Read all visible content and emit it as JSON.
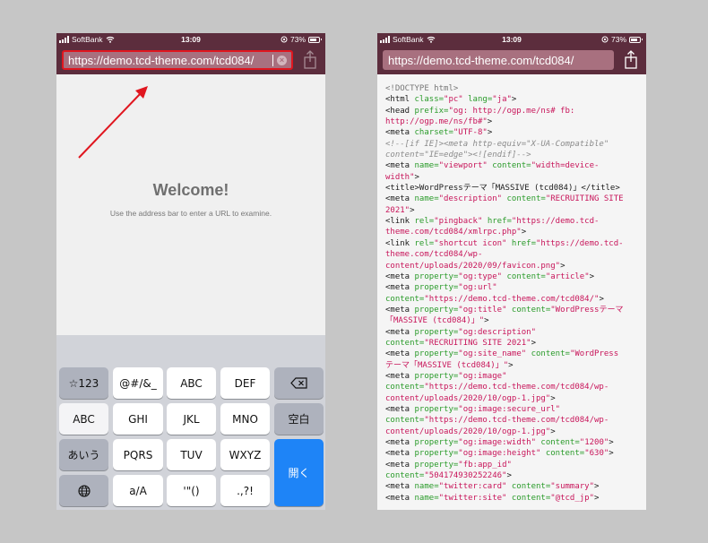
{
  "left_phone": {
    "status": {
      "carrier": "SoftBank",
      "time": "13:09",
      "battery": "73%"
    },
    "address": {
      "value": "https://demo.tcd-theme.com/tcd084/"
    },
    "welcome": {
      "title": "Welcome!",
      "subtitle": "Use the address bar to enter a URL to examine."
    },
    "keyboard": {
      "rows": [
        [
          "☆123",
          "@#/&_",
          "ABC",
          "DEF",
          "⌫"
        ],
        [
          "ABC",
          "GHI",
          "JKL",
          "MNO",
          "空白"
        ],
        [
          "あいう",
          "PQRS",
          "TUV",
          "WXYZ",
          "開く"
        ],
        [
          "globe",
          "a/A",
          "'\"()",
          ".,?!"
        ]
      ]
    }
  },
  "right_phone": {
    "status": {
      "carrier": "SoftBank",
      "time": "13:09",
      "battery": "73%"
    },
    "address": {
      "value": "https://demo.tcd-theme.com/tcd084/"
    },
    "source_lines": [
      [
        [
          "dt",
          "<!DOCTYPE html>"
        ]
      ],
      [
        [
          "tg",
          "<html "
        ],
        [
          "at",
          "class="
        ],
        [
          "vl",
          "\"pc\""
        ],
        [
          "tg",
          " "
        ],
        [
          "at",
          "lang="
        ],
        [
          "vl",
          "\"ja\""
        ],
        [
          "tg",
          ">"
        ]
      ],
      [
        [
          "tg",
          "<head "
        ],
        [
          "at",
          "prefix="
        ],
        [
          "vl",
          "\"og: http://ogp.me/ns# fb:"
        ]
      ],
      [
        [
          "vl",
          "http://ogp.me/ns/fb#\""
        ],
        [
          "tg",
          ">"
        ]
      ],
      [
        [
          "tg",
          "<meta "
        ],
        [
          "at",
          "charset="
        ],
        [
          "vl",
          "\"UTF-8\""
        ],
        [
          "tg",
          ">"
        ]
      ],
      [
        [
          "cm",
          "<!--[if IE]><meta http-equiv=\"X-UA-Compatible\""
        ]
      ],
      [
        [
          "cm",
          "content=\"IE=edge\"><![endif]-->"
        ]
      ],
      [
        [
          "tg",
          "<meta "
        ],
        [
          "at",
          "name="
        ],
        [
          "vl",
          "\"viewport\""
        ],
        [
          "tg",
          " "
        ],
        [
          "at",
          "content="
        ],
        [
          "vl",
          "\"width=device-"
        ]
      ],
      [
        [
          "vl",
          "width\""
        ],
        [
          "tg",
          ">"
        ]
      ],
      [
        [
          "tg",
          "<title>WordPressテーマ「MASSIVE (tcd084)」</title>"
        ]
      ],
      [
        [
          "tg",
          "<meta "
        ],
        [
          "at",
          "name="
        ],
        [
          "vl",
          "\"description\""
        ],
        [
          "tg",
          " "
        ],
        [
          "at",
          "content="
        ],
        [
          "vl",
          "\"RECRUITING SITE"
        ]
      ],
      [
        [
          "vl",
          "2021\""
        ],
        [
          "tg",
          ">"
        ]
      ],
      [
        [
          "tg",
          "<link "
        ],
        [
          "at",
          "rel="
        ],
        [
          "vl",
          "\"pingback\""
        ],
        [
          "tg",
          " "
        ],
        [
          "at",
          "href="
        ],
        [
          "vl",
          "\"https://demo.tcd-"
        ]
      ],
      [
        [
          "vl",
          "theme.com/tcd084/xmlrpc.php\""
        ],
        [
          "tg",
          ">"
        ]
      ],
      [
        [
          "tg",
          "<link "
        ],
        [
          "at",
          "rel="
        ],
        [
          "vl",
          "\"shortcut icon\""
        ],
        [
          "tg",
          " "
        ],
        [
          "at",
          "href="
        ],
        [
          "vl",
          "\"https://demo.tcd-"
        ]
      ],
      [
        [
          "vl",
          "theme.com/tcd084/wp-"
        ]
      ],
      [
        [
          "vl",
          "content/uploads/2020/09/favicon.png\""
        ],
        [
          "tg",
          ">"
        ]
      ],
      [
        [
          "tg",
          "<meta "
        ],
        [
          "at",
          "property="
        ],
        [
          "vl",
          "\"og:type\""
        ],
        [
          "tg",
          " "
        ],
        [
          "at",
          "content="
        ],
        [
          "vl",
          "\"article\""
        ],
        [
          "tg",
          ">"
        ]
      ],
      [
        [
          "tg",
          "<meta "
        ],
        [
          "at",
          "property="
        ],
        [
          "vl",
          "\"og:url\""
        ]
      ],
      [
        [
          "at",
          "content="
        ],
        [
          "vl",
          "\"https://demo.tcd-theme.com/tcd084/\""
        ],
        [
          "tg",
          ">"
        ]
      ],
      [
        [
          "tg",
          "<meta "
        ],
        [
          "at",
          "property="
        ],
        [
          "vl",
          "\"og:title\""
        ],
        [
          "tg",
          " "
        ],
        [
          "at",
          "content="
        ],
        [
          "vl",
          "\"WordPressテーマ"
        ]
      ],
      [
        [
          "vl",
          "「MASSIVE (tcd084)」\""
        ],
        [
          "tg",
          ">"
        ]
      ],
      [
        [
          "tg",
          "<meta "
        ],
        [
          "at",
          "property="
        ],
        [
          "vl",
          "\"og:description\""
        ]
      ],
      [
        [
          "at",
          "content="
        ],
        [
          "vl",
          "\"RECRUITING SITE 2021\""
        ],
        [
          "tg",
          ">"
        ]
      ],
      [
        [
          "tg",
          "<meta "
        ],
        [
          "at",
          "property="
        ],
        [
          "vl",
          "\"og:site_name\""
        ],
        [
          "tg",
          " "
        ],
        [
          "at",
          "content="
        ],
        [
          "vl",
          "\"WordPress"
        ]
      ],
      [
        [
          "vl",
          "テーマ「MASSIVE (tcd084)」\""
        ],
        [
          "tg",
          ">"
        ]
      ],
      [
        [
          "tg",
          "<meta "
        ],
        [
          "at",
          "property="
        ],
        [
          "vl",
          "\"og:image\""
        ]
      ],
      [
        [
          "at",
          "content="
        ],
        [
          "vl",
          "\"https://demo.tcd-theme.com/tcd084/wp-"
        ]
      ],
      [
        [
          "vl",
          "content/uploads/2020/10/ogp-1.jpg\""
        ],
        [
          "tg",
          ">"
        ]
      ],
      [
        [
          "tg",
          "<meta "
        ],
        [
          "at",
          "property="
        ],
        [
          "vl",
          "\"og:image:secure_url\""
        ]
      ],
      [
        [
          "at",
          "content="
        ],
        [
          "vl",
          "\"https://demo.tcd-theme.com/tcd084/wp-"
        ]
      ],
      [
        [
          "vl",
          "content/uploads/2020/10/ogp-1.jpg\""
        ],
        [
          "tg",
          ">"
        ]
      ],
      [
        [
          "tg",
          "<meta "
        ],
        [
          "at",
          "property="
        ],
        [
          "vl",
          "\"og:image:width\""
        ],
        [
          "tg",
          " "
        ],
        [
          "at",
          "content="
        ],
        [
          "vl",
          "\"1200\""
        ],
        [
          "tg",
          ">"
        ]
      ],
      [
        [
          "tg",
          "<meta "
        ],
        [
          "at",
          "property="
        ],
        [
          "vl",
          "\"og:image:height\""
        ],
        [
          "tg",
          " "
        ],
        [
          "at",
          "content="
        ],
        [
          "vl",
          "\"630\""
        ],
        [
          "tg",
          ">"
        ]
      ],
      [
        [
          "tg",
          "<meta "
        ],
        [
          "at",
          "property="
        ],
        [
          "vl",
          "\"fb:app_id\""
        ]
      ],
      [
        [
          "at",
          "content="
        ],
        [
          "vl",
          "\"504174930252246\""
        ],
        [
          "tg",
          ">"
        ]
      ],
      [
        [
          "tg",
          "<meta "
        ],
        [
          "at",
          "name="
        ],
        [
          "vl",
          "\"twitter:card\""
        ],
        [
          "tg",
          " "
        ],
        [
          "at",
          "content="
        ],
        [
          "vl",
          "\"summary\""
        ],
        [
          "tg",
          ">"
        ]
      ],
      [
        [
          "tg",
          "<meta "
        ],
        [
          "at",
          "name="
        ],
        [
          "vl",
          "\"twitter:site\""
        ],
        [
          "tg",
          " "
        ],
        [
          "at",
          "content="
        ],
        [
          "vl",
          "\"@tcd_jp\""
        ],
        [
          "tg",
          ">"
        ]
      ]
    ]
  },
  "colors": {
    "toolbar": "#5c2d3d",
    "address_bg": "#a8707f",
    "highlight": "#e0161f",
    "open_key": "#1e84f7"
  }
}
